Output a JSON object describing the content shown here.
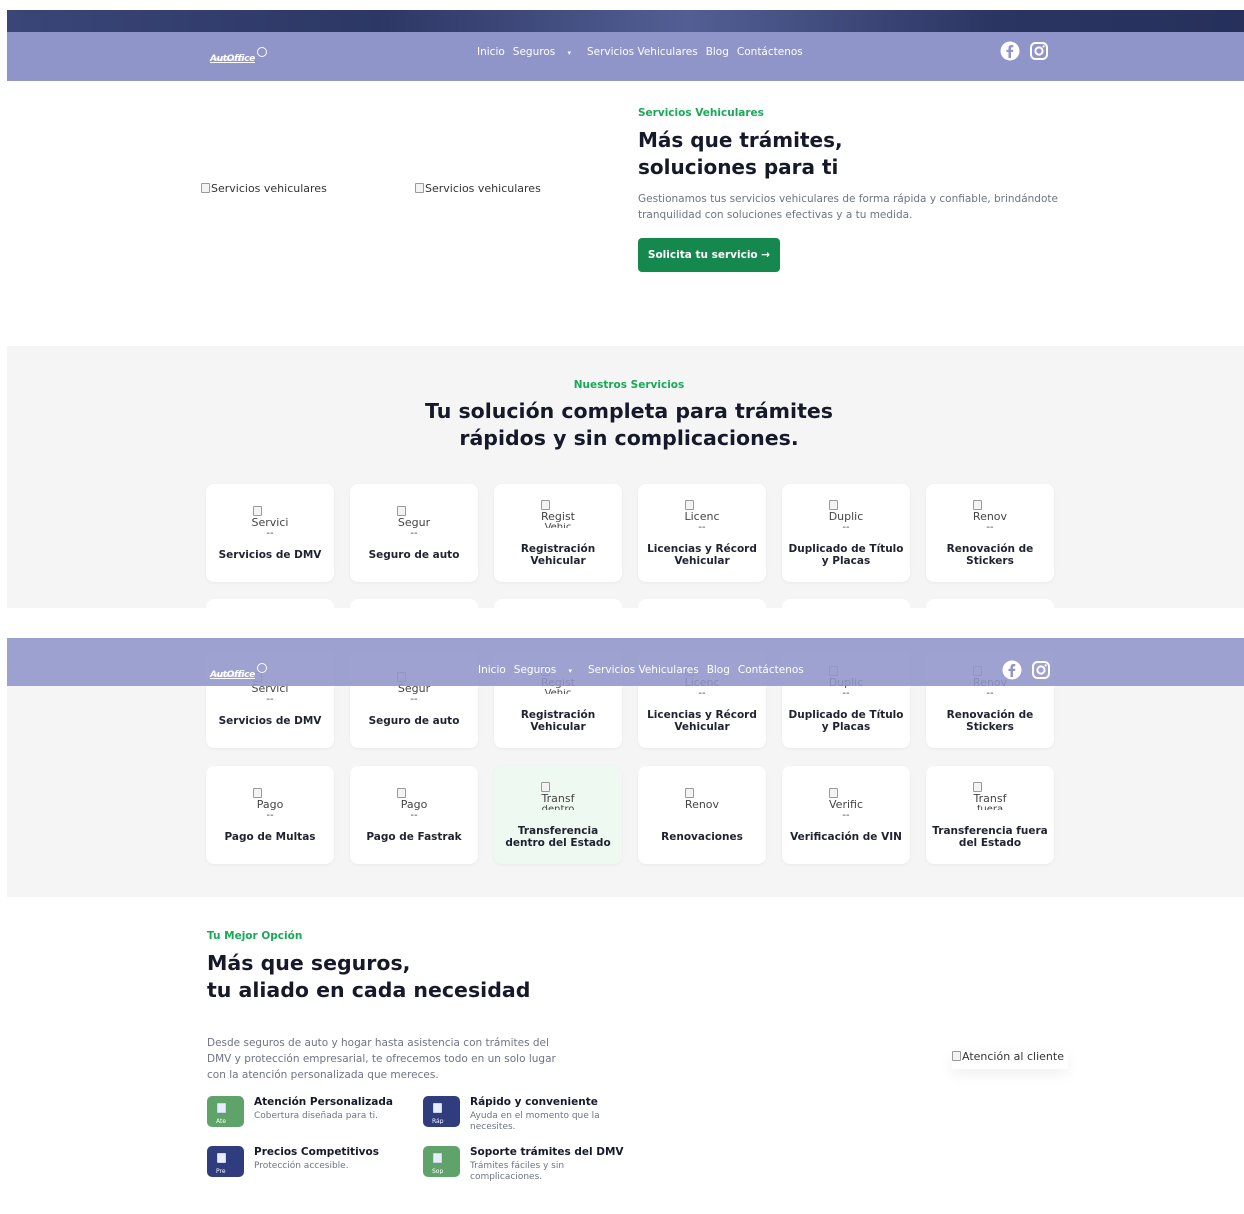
{
  "header": {
    "logo_text": "AutOffice",
    "logo_sub": "Multiservicios",
    "menu": [
      "Inicio",
      "Seguros",
      "Servicios Vehiculares",
      "Blog",
      "Contáctenos"
    ],
    "social": [
      "facebook-icon",
      "instagram-icon"
    ]
  },
  "hero": {
    "image_alts": [
      "Servicios vehiculares",
      "Servicios vehiculares"
    ],
    "eyebrow": "Servicios Vehiculares",
    "title_line1": "Más que trámites,",
    "title_line2": "soluciones para ti",
    "lead_line1": "Gestionamos tus servicios vehiculares de forma rápida y confiable, brindándote",
    "lead_line2": "tranquilidad con soluciones efectivas y a tu medida.",
    "cta": "Solicita tu servicio →"
  },
  "services": {
    "eyebrow": "Nuestros Servicios",
    "title_line1": "Tu solución completa para trámites",
    "title_line2": "rápidos y sin complicaciones.",
    "row1": [
      {
        "alt": "Servici",
        "alt2": "-- ",
        "title1": "Servicios de DMV",
        "title2": ""
      },
      {
        "alt": "Segur",
        "alt2": "-- ",
        "title1": "Seguro de auto",
        "title2": ""
      },
      {
        "alt": "Regist",
        "alt2": "Vehic",
        "title1": "Registración",
        "title2": "Vehicular"
      },
      {
        "alt": "Licenc",
        "alt2": "-- ",
        "title1": "Licencias y Récord",
        "title2": "Vehicular"
      },
      {
        "alt": "Duplic",
        "alt2": "-- ",
        "title1": "Duplicado de Título",
        "title2": "y Placas"
      },
      {
        "alt": "Renov",
        "alt2": "-- ",
        "title1": "Renovación de",
        "title2": "Stickers"
      }
    ],
    "row2": [
      {
        "alt": "Pago",
        "alt2": "-- ",
        "title1": "Pago de Multas",
        "title2": ""
      },
      {
        "alt": "Pago",
        "alt2": "-- ",
        "title1": "Pago de Fastrak",
        "title2": ""
      },
      {
        "alt": "Transf",
        "alt2": "dentro",
        "title1": "Transferencia",
        "title2": "dentro del Estado"
      },
      {
        "alt": "Renov",
        "alt2": "",
        "title1": "Renovaciones",
        "title2": ""
      },
      {
        "alt": "Verific",
        "alt2": "-- ",
        "title1": "Verificación de VIN",
        "title2": ""
      },
      {
        "alt": "Transf",
        "alt2": "fuera",
        "title1": "Transferencia fuera",
        "title2": "del Estado"
      }
    ]
  },
  "option": {
    "eyebrow": "Tu Mejor Opción",
    "title_line1": "Más que seguros,",
    "title_line2": "tu aliado en cada necesidad",
    "lead_line1": "Desde seguros de auto y hogar hasta asistencia con trámites del",
    "lead_line2": "DMV y protección empresarial, te ofrecemos todo en un solo lugar",
    "lead_line3": "con la atención personalizada que mereces.",
    "image_alt": "Atención al cliente",
    "features": [
      {
        "title": "Atención Personalizada",
        "d1": "Cobertura diseñada para ti.",
        "d2": "",
        "alt": "Ate",
        "color": "#5fa36a"
      },
      {
        "title": "Rápido y conveniente",
        "d1": "Ayuda en el momento que la",
        "d2": "necesites.",
        "alt": "Ráp",
        "color": "#2f3c7e"
      },
      {
        "title": "Precios Competitivos",
        "d1": "Protección accesible.",
        "d2": "",
        "alt": "Pre",
        "color": "#2f3c7e"
      },
      {
        "title": "Soporte trámites del DMV",
        "d1": "Trámites fáciles y sin",
        "d2": "complicaciones.",
        "alt": "Sop",
        "color": "#5fa36a"
      }
    ]
  },
  "colors": {
    "nav": "#8f95c9",
    "accent": "#18a957",
    "cta": "#15894d"
  }
}
